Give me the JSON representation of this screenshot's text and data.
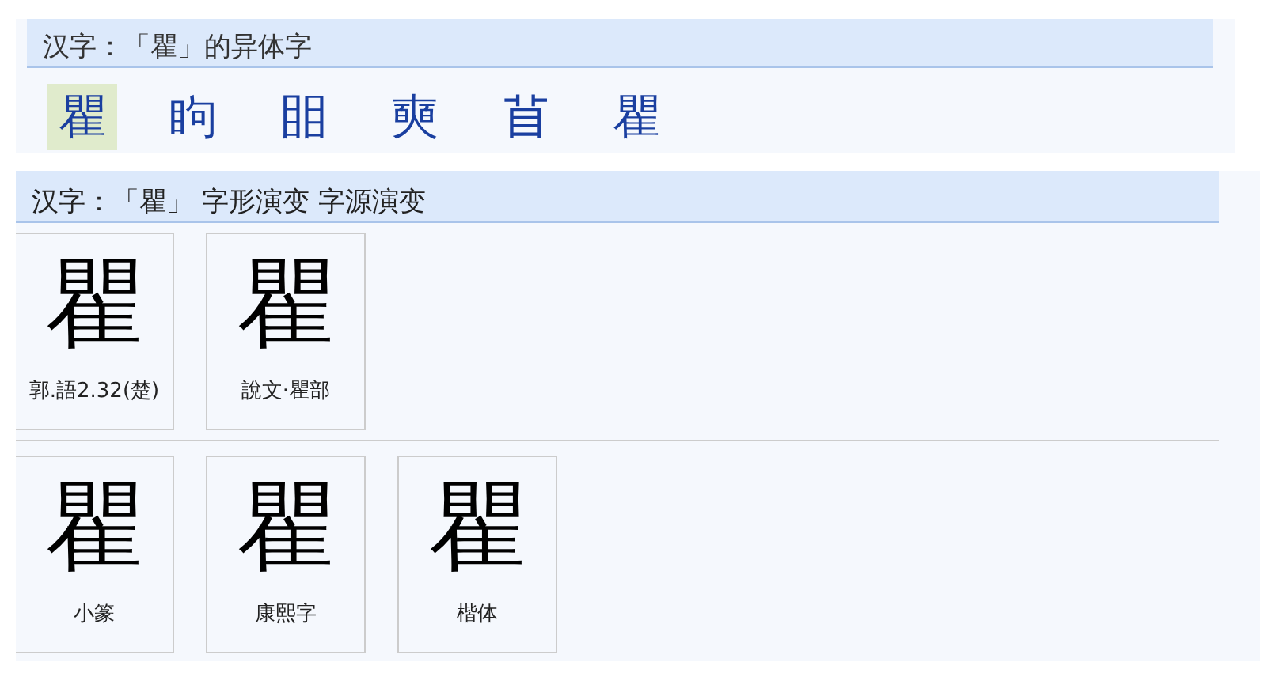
{
  "variants": {
    "title": "汉字：「瞿」的异体字",
    "items": [
      {
        "char": "瞿",
        "selected": true
      },
      {
        "char": "眗",
        "selected": false
      },
      {
        "char": "䀠",
        "selected": false
      },
      {
        "char": "奭",
        "selected": false
      },
      {
        "char": "𥄕",
        "selected": false
      },
      {
        "char": "瞿",
        "selected": false
      }
    ]
  },
  "evolution": {
    "title": "汉字：「瞿」 字形演变 字源演变",
    "groups": [
      [
        {
          "glyph": "瞿",
          "caption": "郭.語2.32(楚)"
        },
        {
          "glyph": "瞿",
          "caption": "說文·瞿部"
        }
      ],
      [
        {
          "glyph": "瞿",
          "caption": "小篆"
        },
        {
          "glyph": "瞿",
          "caption": "康熙字"
        },
        {
          "glyph": "瞿",
          "caption": "楷体"
        }
      ]
    ]
  }
}
